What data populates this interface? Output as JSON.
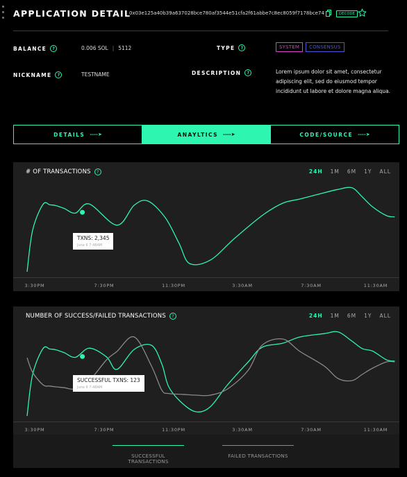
{
  "header": {
    "title": "APPLICATION DETAIL",
    "hash": "0x03e125a40b39a637028bce780af3544e51cfa2f61abbe7c8ec8059f7178bce74",
    "badge": "DECODE"
  },
  "details": {
    "balance_label": "BALANCE",
    "balance_value": "0.006 SOL",
    "balance_extra": "5112",
    "nickname_label": "NICKNAME",
    "nickname_value": "TESTNAME",
    "type_label": "TYPE",
    "type_tags": [
      "SYSTEM",
      "CONSENSUS"
    ],
    "description_label": "DESCRIPTION",
    "description_value": "Lorem ipsum dolor sit amet, consectetur adipiscing elit, sed do eiusmod tempor incididunt ut labore et dolore magna aliqua.",
    "help_glyph": "?"
  },
  "tabs": [
    {
      "label": "DETAILS",
      "arrow": "----➤",
      "active": false
    },
    {
      "label": "ANAYLTICS",
      "arrow": "----➤",
      "active": true
    },
    {
      "label": "CODE/SOURCE",
      "arrow": "----➤",
      "active": false
    }
  ],
  "colors": {
    "accent": "#2ef5b0",
    "failed_series": "#8a8a8a",
    "type_system": "#d63fd0",
    "type_consensus": "#4b55d9"
  },
  "icons": {
    "copy": "copy-icon",
    "favorite": "star-icon",
    "help": "help-icon",
    "drag": "drag-handle-icon"
  },
  "transactions_panel": {
    "title": "# OF TRANSACTIONS",
    "ranges": [
      "24H",
      "1M",
      "6M",
      "1Y",
      "ALL"
    ],
    "selected_range": "24H",
    "tooltip": {
      "title": "TXNS: 2,345",
      "subtitle": "June 6 7:48AM"
    }
  },
  "success_failed_panel": {
    "title": "NUMBER OF SUCCESS/FAILED TRANSACTIONS",
    "ranges": [
      "24H",
      "1M",
      "6M",
      "1Y",
      "ALL"
    ],
    "selected_range": "24H",
    "tooltip": {
      "title": "SUCCESSFUL TXNS: 123",
      "subtitle": "June 6 7:48AM"
    }
  },
  "legend": {
    "successful": "SUCCESSFUL TRANSACTIONS",
    "failed": "FAILED TRANSACTIONS"
  },
  "chart_data": [
    {
      "type": "line",
      "title": "# OF TRANSACTIONS",
      "xlabel": "",
      "ylabel": "",
      "x_tick_labels": [
        "3:30PM",
        "7:30PM",
        "11:30PM",
        "3:30AM",
        "7:30AM",
        "11:30AM"
      ],
      "x": [
        0,
        0.08,
        0.23,
        0.33,
        0.42,
        0.54,
        0.7,
        0.9,
        1.3,
        1.55,
        1.75,
        2.0,
        2.2,
        2.35,
        2.65,
        3.0,
        3.4,
        3.7,
        3.95,
        4.3,
        4.5,
        4.7,
        4.85,
        5.0,
        5.2,
        5.32
      ],
      "series": [
        {
          "name": "",
          "values": [
            0.2,
            1.2,
            1.82,
            1.81,
            1.79,
            1.72,
            1.61,
            1.83,
            1.32,
            1.8,
            1.9,
            1.5,
            0.88,
            0.4,
            0.48,
            1.0,
            1.55,
            1.85,
            1.95,
            2.1,
            2.18,
            2.22,
            2.0,
            1.76,
            1.55,
            1.52
          ]
        }
      ],
      "highlight_point": {
        "x": 0.8,
        "y": 1.63
      }
    },
    {
      "type": "line",
      "title": "NUMBER OF SUCCESS/FAILED TRANSACTIONS",
      "xlabel": "",
      "ylabel": "",
      "x_tick_labels": [
        "3:30PM",
        "7:30PM",
        "11:30PM",
        "3:30AM",
        "7:30AM",
        "11:30AM"
      ],
      "x": [
        0,
        0.08,
        0.23,
        0.33,
        0.42,
        0.54,
        0.7,
        0.9,
        1.15,
        1.3,
        1.55,
        1.8,
        1.95,
        2.05,
        2.25,
        2.45,
        2.65,
        2.9,
        3.2,
        3.4,
        3.7,
        3.95,
        4.3,
        4.5,
        4.7,
        4.85,
        5.0,
        5.2,
        5.32
      ],
      "series": [
        {
          "name": "SUCCESSFUL TRANSACTIONS",
          "values": [
            0.2,
            1.2,
            1.82,
            1.81,
            1.79,
            1.72,
            1.61,
            1.83,
            1.62,
            1.32,
            1.8,
            1.9,
            1.45,
            0.9,
            0.5,
            0.3,
            0.42,
            0.95,
            1.5,
            1.85,
            1.95,
            2.1,
            2.18,
            2.22,
            2.0,
            1.82,
            1.76,
            1.55,
            1.52
          ]
        },
        {
          "name": "FAILED TRANSACTIONS",
          "values": [
            1.6,
            1.25,
            0.95,
            0.92,
            0.9,
            0.88,
            0.85,
            1.05,
            1.55,
            1.75,
            2.1,
            1.4,
            0.82,
            0.74,
            0.72,
            0.7,
            0.7,
            0.85,
            1.3,
            1.9,
            2.05,
            1.75,
            1.4,
            1.1,
            1.05,
            1.2,
            1.35,
            1.5,
            1.5
          ]
        }
      ],
      "highlight_point": {
        "x": 0.8,
        "y": 1.63
      }
    }
  ]
}
